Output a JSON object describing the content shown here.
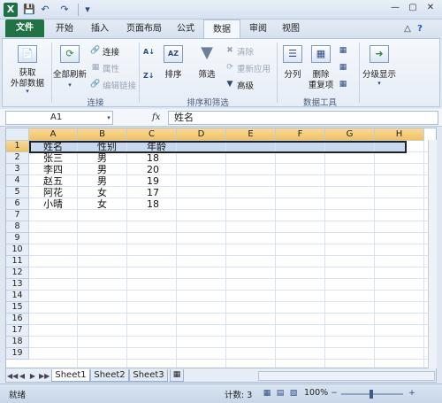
{
  "titlebar": {
    "logo": "X",
    "quick_access": [
      "save-icon",
      "undo-icon",
      "redo-icon"
    ],
    "window_controls": [
      "minimize",
      "maximize",
      "close"
    ]
  },
  "tabs": [
    {
      "label": "文件"
    },
    {
      "label": "开始"
    },
    {
      "label": "插入"
    },
    {
      "label": "页面布局"
    },
    {
      "label": "公式"
    },
    {
      "label": "数据",
      "active": true
    },
    {
      "label": "审阅"
    },
    {
      "label": "视图"
    }
  ],
  "ribbon": {
    "get_external": {
      "line1": "获取",
      "line2": "外部数据"
    },
    "refresh_all": "全部刷新",
    "connections": "连接",
    "properties": "属性",
    "edit_links": "编辑链接",
    "sort": "排序",
    "filter": "筛选",
    "clear": "清除",
    "reapply": "重新应用",
    "advanced": "高级",
    "text_to_columns": "分列",
    "remove_duplicates": {
      "line1": "删除",
      "line2": "重复项"
    },
    "outline": "分级显示",
    "groups": {
      "connections": "连接",
      "sort_filter": "排序和筛选",
      "data_tools": "数据工具"
    }
  },
  "formula_bar": {
    "name_box": "A1",
    "fx": "fx",
    "content": "姓名"
  },
  "grid": {
    "columns": [
      "A",
      "B",
      "C",
      "D",
      "E",
      "F",
      "G",
      "H"
    ],
    "selected_columns": [
      "A",
      "B",
      "C",
      "D",
      "E",
      "F",
      "G",
      "H"
    ],
    "rows": [
      "1",
      "2",
      "3",
      "4",
      "5",
      "6",
      "7",
      "8",
      "9",
      "10",
      "11",
      "12",
      "13",
      "14",
      "15",
      "16",
      "17",
      "18",
      "19"
    ],
    "selected_row": "1",
    "data": [
      [
        "姓名",
        "性别",
        "年龄"
      ],
      [
        "张三",
        "男",
        "18"
      ],
      [
        "李四",
        "男",
        "20"
      ],
      [
        "赵五",
        "男",
        "19"
      ],
      [
        "阿花",
        "女",
        "17"
      ],
      [
        "小晴",
        "女",
        "18"
      ]
    ]
  },
  "sheets": [
    "Sheet1",
    "Sheet2",
    "Sheet3"
  ],
  "active_sheet": "Sheet1",
  "status": {
    "mode": "就绪",
    "count": "计数: 3",
    "zoom": "100%"
  }
}
